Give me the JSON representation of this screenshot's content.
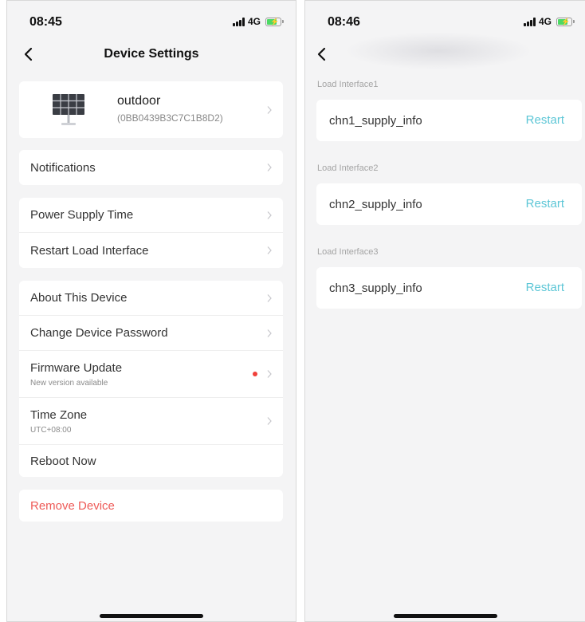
{
  "left_screen": {
    "status_bar": {
      "time": "08:45",
      "network": "4G"
    },
    "nav": {
      "title": "Device Settings"
    },
    "device": {
      "name": "outdoor",
      "id": "(0BB0439B3C7C1B8D2)",
      "icon": "solar-panel-icon"
    },
    "groups": [
      {
        "items": [
          {
            "label": "Notifications"
          }
        ]
      },
      {
        "items": [
          {
            "label": "Power Supply Time"
          },
          {
            "label": "Restart Load Interface"
          }
        ]
      },
      {
        "items": [
          {
            "label": "About This Device"
          },
          {
            "label": "Change Device Password"
          },
          {
            "label": "Firmware Update",
            "sub": "New version available",
            "badge": "red-dot"
          },
          {
            "label": "Time Zone",
            "sub": "UTC+08:00"
          },
          {
            "label": "Reboot Now"
          }
        ]
      }
    ],
    "remove": {
      "label": "Remove Device",
      "color": "#ee5a57"
    }
  },
  "right_screen": {
    "status_bar": {
      "time": "08:46",
      "network": "4G"
    },
    "interfaces": [
      {
        "section": "Load Interface1",
        "label": "chn1_supply_info",
        "action": "Restart"
      },
      {
        "section": "Load Interface2",
        "label": "chn2_supply_info",
        "action": "Restart"
      },
      {
        "section": "Load Interface3",
        "label": "chn3_supply_info",
        "action": "Restart"
      }
    ]
  },
  "colors": {
    "accent": "#5cc6d6",
    "danger": "#ee5a57",
    "background": "#f4f4f5",
    "battery": "#4cd964"
  }
}
